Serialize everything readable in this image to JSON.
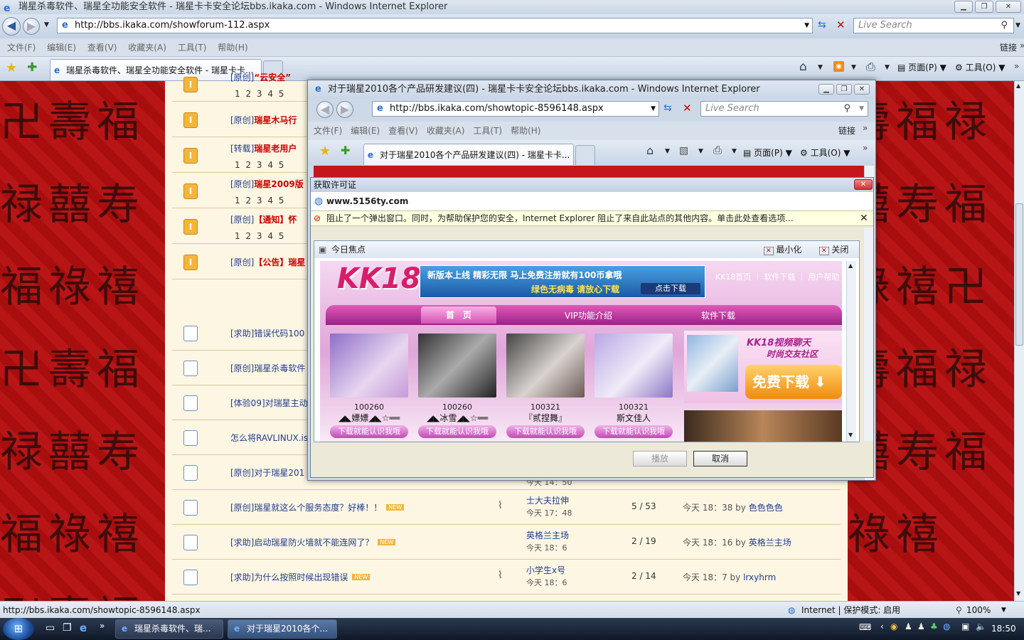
{
  "browser": {
    "title": "瑞星杀毒软件、瑞星全功能安全软件 - 瑞星卡卡安全论坛bbs.ikaka.com - Windows Internet Explorer",
    "url": "http://bbs.ikaka.com/showforum-112.aspx",
    "search_placeholder": "Live Search",
    "menu": [
      "文件(F)",
      "编辑(E)",
      "查看(V)",
      "收藏夹(A)",
      "工具(T)",
      "帮助(H)"
    ],
    "links_label": "链接",
    "tab_label": "瑞星杀毒软件、瑞星全功能安全软件 - 瑞星卡卡...",
    "page_menu": "页面(P)",
    "tools_menu": "工具(O)",
    "status_url": "http://bbs.ikaka.com/showtopic-8596148.aspx",
    "status_zone": "Internet | 保护模式: 启用",
    "zoom": "100%"
  },
  "forum": {
    "rows": [
      {
        "icon": "orange",
        "prefix": "[原创]",
        "title": "“云安全”",
        "red": true,
        "pages": "1 2 3 4 5"
      },
      {
        "icon": "orange",
        "prefix": "[原创]",
        "title": "瑞星木马行"
      },
      {
        "icon": "orange",
        "prefix": "[转载]",
        "title": "瑞星老用户",
        "pages": "1 2 3 4 5"
      },
      {
        "icon": "orange",
        "prefix": "[原创]",
        "title": "瑞星2009版",
        "pages": "1 2 3 4 5"
      },
      {
        "icon": "orange",
        "prefix": "[原创]",
        "title": "【通知】怀",
        "pages": "1 2 3 4 5"
      },
      {
        "icon": "orange",
        "prefix": "[原创]",
        "title": "【公告】瑞星"
      },
      {
        "icon": "doc",
        "prefix": "[求助]",
        "title": "错误代码100"
      },
      {
        "icon": "doc",
        "prefix": "[原创]",
        "title": "瑞星杀毒软件"
      },
      {
        "icon": "doc",
        "prefix": "[体验09]",
        "title": "对瑞星主动"
      },
      {
        "icon": "doc",
        "prefix": "",
        "title": "怎么将RAVLINUX.iso"
      },
      {
        "icon": "doc",
        "prefix": "[原创]",
        "title": "对于瑞星201"
      },
      {
        "icon": "doc",
        "prefix": "[原创]",
        "title": "瑞星就这么个服务态度？好棒！！",
        "author": "士大夫拉伸",
        "time": "今天 17：48",
        "count": "5 / 53",
        "last": "今天 18：38 by",
        "lastuser": "色色色色"
      },
      {
        "icon": "doc",
        "prefix": "[求助]",
        "title": "启动瑞星防火墙就不能连网了？",
        "author": "英格兰主场",
        "time": "今天 18：6",
        "count": "2 / 19",
        "last": "今天 18：16 by",
        "lastuser": "英格兰主场"
      },
      {
        "icon": "doc",
        "prefix": "[求助]",
        "title": "为什么按照时候出现错误",
        "author": "小学生x号",
        "time": "今天 18：6",
        "count": "2 / 14",
        "last": "今天 18：7 by",
        "lastuser": "lrxyhrm"
      }
    ],
    "partial_time": "今天 14：50"
  },
  "popup": {
    "title": "对于瑞星2010各个产品研发建议(四) - 瑞星卡卡安全论坛bbs.ikaka.com - Windows Internet Explorer",
    "url": "http://bbs.ikaka.com/showtopic-8596148.aspx",
    "tab_label": "对于瑞星2010各个产品研发建议(四) - 瑞星卡卡...",
    "links_label": "链接",
    "page_menu": "页面(P)",
    "tools_menu": "工具(O)"
  },
  "dialog": {
    "title": "获取许可证",
    "site": "www.5156ty.com",
    "infobar": "阻止了一个弹出窗口。同时，为帮助保护您的安全，Internet Explorer 阻止了来自此站点的其他内容。单击此处查看选项...",
    "inner_title": "今日焦点",
    "minimize": "最小化",
    "close": "关闭",
    "play": "播放",
    "cancel": "取消"
  },
  "kk18": {
    "logo": "KK18",
    "banner1": "新版本上线  精彩无限  马上免费注册就有100",
    "banner1b": "币拿哦",
    "banner2": "绿色无病毒  请放心下载",
    "banner_btn": "点击下载",
    "toplinks": "KK18首页 ｜ 软件下载 ｜ 用户帮助",
    "nav": [
      "首　页",
      "VIP功能介绍",
      "软件下载"
    ],
    "promo_title": "KK18视频聊天",
    "promo_sub": "时尚交友社区",
    "promo_btn": "免费下载",
    "girls": [
      {
        "num": "100260",
        "name": "◢◣嫖嫖◢◣☆══",
        "btn": "下载就能认识我哦"
      },
      {
        "num": "100260",
        "name": "◢◣冰雪◢◣☆══",
        "btn": "下载就能认识我哦"
      },
      {
        "num": "100321",
        "name": "『贰捏舞』",
        "btn": "下载就能认识我哦"
      },
      {
        "num": "100321",
        "name": "斯文佳人",
        "btn": "下载就能认识我哦"
      }
    ]
  },
  "taskbar": {
    "task1": "瑞星杀毒软件、瑞...",
    "task2": "对于瑞星2010各个...",
    "clock": "18:50"
  }
}
